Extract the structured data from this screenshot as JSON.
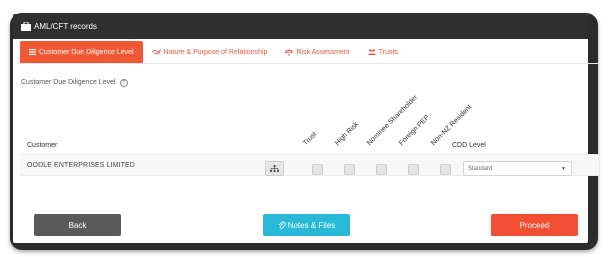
{
  "window": {
    "title": "AML/CFT records"
  },
  "tabs": [
    {
      "label": "Customer Due Diligence Level",
      "icon": "list-icon",
      "active": true
    },
    {
      "label": "Nature & Purpose of Relationship",
      "icon": "handshake-icon",
      "active": false
    },
    {
      "label": "Risk Assessment",
      "icon": "scales-icon",
      "active": false
    },
    {
      "label": "Trusts",
      "icon": "people-icon",
      "active": false
    }
  ],
  "section": {
    "label": "Customer Due Diligence Level",
    "help_icon": "?"
  },
  "table": {
    "customer_header": "Customer",
    "cdd_header": "CDD Level",
    "risk_columns": [
      "Trust",
      "High Risk",
      "Nominee Shareholder",
      "Foreign PEP",
      "Non-NZ Resident"
    ],
    "rows": [
      {
        "customer": "OODLE ENTERPRISES LIMITED",
        "flags": [
          false,
          false,
          false,
          false,
          false
        ],
        "cdd_level": "Standard"
      }
    ]
  },
  "buttons": {
    "back": "Back",
    "notes": "Notes & Files",
    "proceed": "Proceed"
  },
  "colors": {
    "accent": "#f25833",
    "notes_button": "#29b8d8",
    "back_button": "#5a5a5a",
    "titlebar": "#2f2f2f"
  }
}
